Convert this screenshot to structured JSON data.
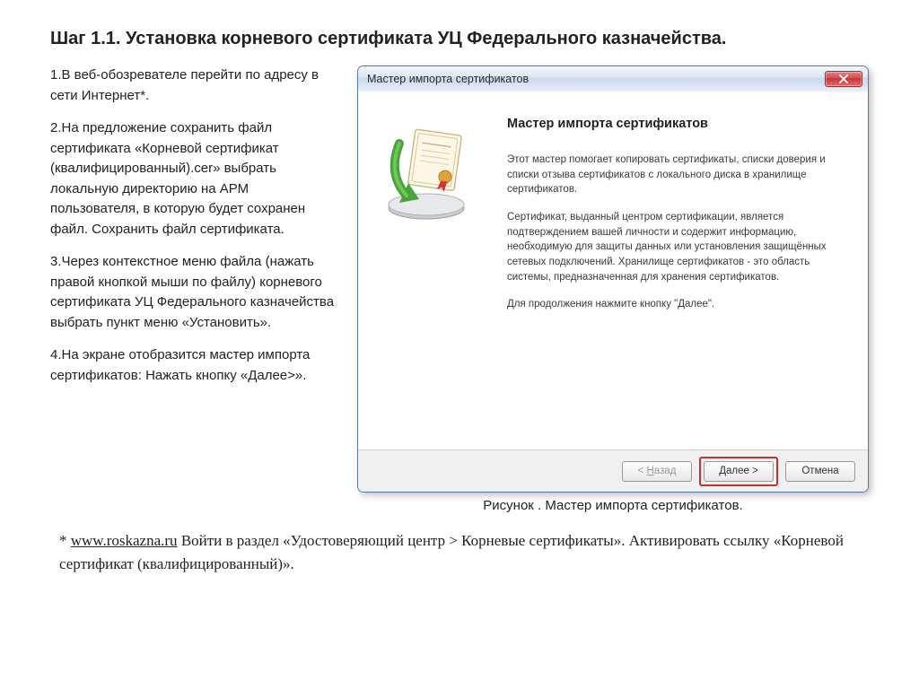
{
  "heading": "Шаг 1.1. Установка корневого сертификата УЦ Федерального казначейства.",
  "steps": {
    "s1": "1.В веб-обозревателе перейти по адресу в сети Интернет*.",
    "s2": "2.На предложение сохранить файл сертификата «Корневой сертификат (квалифицированный).cer» выбрать локальную директорию на АРМ пользователя, в которую будет сохранен файл. Сохранить файл сертификата.",
    "s3": "3.Через контекстное меню файла (нажать правой кнопкой мыши по файлу) корневого сертификата УЦ Федерального казначейства выбрать пункт меню «Установить».",
    "s4": "4.На экране отобразится мастер импорта сертификатов: Нажать кнопку «Далее>»."
  },
  "wizard": {
    "window_title": "Мастер импорта сертификатов",
    "heading": "Мастер импорта сертификатов",
    "p1": "Этот мастер помогает копировать сертификаты, списки доверия и списки отзыва сертификатов с локального диска в хранилище сертификатов.",
    "p2": "Сертификат, выданный центром сертификации, является подтверждением вашей личности и содержит информацию, необходимую для защиты данных или установления защищённых сетевых подключений. Хранилище сертификатов - это область системы, предназначенная для хранения сертификатов.",
    "p3": "Для продолжения нажмите кнопку \"Далее\".",
    "buttons": {
      "back": "< Назад",
      "next": "Далее >",
      "cancel": "Отмена"
    }
  },
  "caption": "Рисунок . Мастер импорта сертификатов.",
  "footnote": {
    "prefix": "* ",
    "link": "www.roskazna.ru",
    "rest": "  Войти в раздел «Удостоверяющий центр > Корневые сертификаты». Активировать ссылку «Корневой сертификат (квалифицированный)»."
  }
}
